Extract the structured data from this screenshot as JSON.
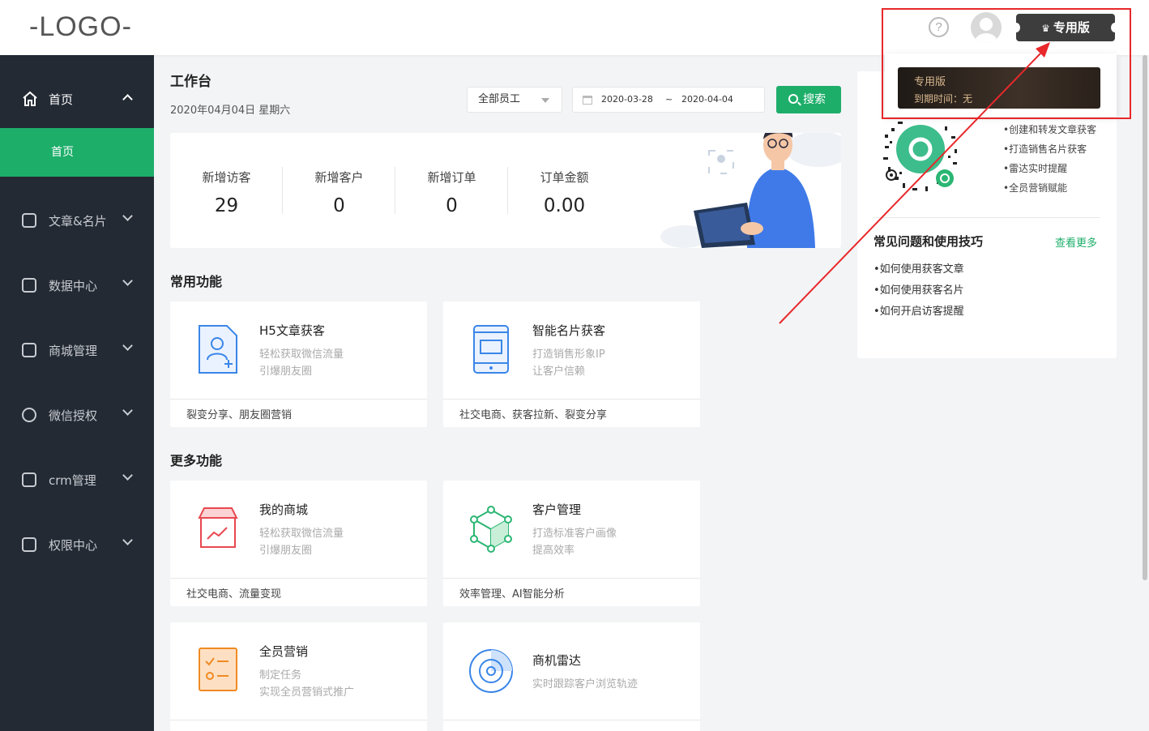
{
  "header": {
    "logo": "-LOGO-",
    "help_icon": "help-icon",
    "badge_label": "专用版",
    "popup": {
      "title": "专用版",
      "expiry": "到期时间：无"
    }
  },
  "sidebar": {
    "items": [
      {
        "label": "首页",
        "icon": "home-icon"
      },
      {
        "label": "文章&名片",
        "icon": "briefcase-icon"
      },
      {
        "label": "数据中心",
        "icon": "chart-icon"
      },
      {
        "label": "商城管理",
        "icon": "store-icon"
      },
      {
        "label": "微信授权",
        "icon": "wechat-icon"
      },
      {
        "label": "crm管理",
        "icon": "crm-icon"
      },
      {
        "label": "权限中心",
        "icon": "lock-icon"
      }
    ],
    "sub_item": "首页"
  },
  "main": {
    "title": "工作台",
    "date": "2020年04月04日 星期六",
    "staff_select": "全部员工",
    "date_from": "2020-03-28",
    "date_sep": "~",
    "date_to": "2020-04-04",
    "search_label": "搜索",
    "stats": [
      {
        "label": "新增访客",
        "value": "29"
      },
      {
        "label": "新增客户",
        "value": "0"
      },
      {
        "label": "新增订单",
        "value": "0"
      },
      {
        "label": "订单金额",
        "value": "0.00"
      }
    ],
    "common_title": "常用功能",
    "more_title": "更多功能",
    "common_cards": [
      {
        "title": "H5文章获客",
        "d1": "轻松获取微信流量",
        "d2": "引爆朋友圈",
        "footer": "裂变分享、朋友圈营销"
      },
      {
        "title": "智能名片获客",
        "d1": "打造销售形象IP",
        "d2": "让客户信赖",
        "footer": "社交电商、获客拉新、裂变分享"
      }
    ],
    "more_cards": [
      {
        "title": "我的商城",
        "d1": "轻松获取微信流量",
        "d2": "引爆朋友圈",
        "footer": "社交电商、流量变现"
      },
      {
        "title": "客户管理",
        "d1": "打造标准客户画像",
        "d2": "提高效率",
        "footer": "效率管理、AI智能分析"
      },
      {
        "title": "全员营销",
        "d1": "制定任务",
        "d2": "实现全员营销式推广",
        "footer": ""
      },
      {
        "title": "商机雷达",
        "d1": "实时跟踪客户浏览轨迹",
        "d2": "",
        "footer": ""
      }
    ]
  },
  "right_panel": {
    "bullets": [
      "创建和转发文章获客",
      "打造销售名片获客",
      "雷达实时提醒",
      "全员营销赋能"
    ],
    "faq_title": "常见问题和使用技巧",
    "faq_more": "查看更多",
    "faq_items": [
      "如何使用获客文章",
      "如何使用获客名片",
      "如何开启访客提醒"
    ]
  },
  "colors": {
    "accent": "#1dae6a",
    "sidebar": "#232a34",
    "annotation": "#e8282b"
  }
}
